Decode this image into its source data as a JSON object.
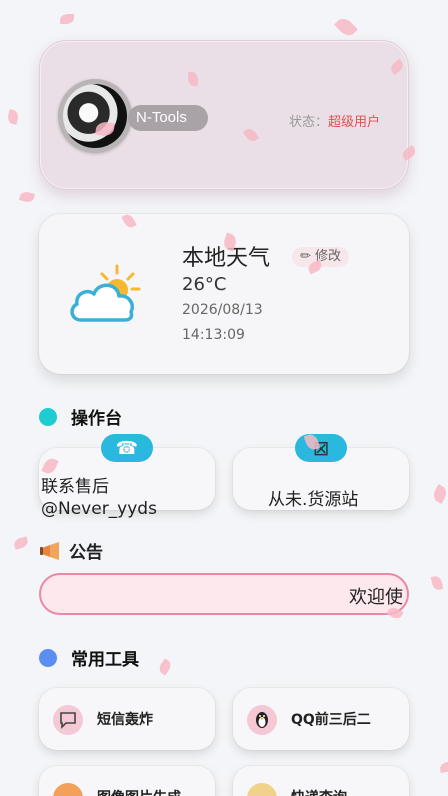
{
  "profile": {
    "app_name": "N-Tools",
    "status_label": "状态：",
    "status_value": "超级用户"
  },
  "weather": {
    "title": "本地天气",
    "edit_label": "修改",
    "temperature": "26°C",
    "date": "2026/08/13",
    "time": "14:13:09"
  },
  "console": {
    "title": "操作台",
    "tiles": [
      {
        "text": "联系售后 @Never_yyds"
      },
      {
        "text": "从未.货源站"
      }
    ]
  },
  "notice": {
    "title": "公告",
    "marquee": "欢迎使"
  },
  "tools": {
    "title": "常用工具",
    "items": [
      {
        "label": "短信轰炸"
      },
      {
        "label": "QQ前三后二"
      },
      {
        "label": "图像图片生成"
      },
      {
        "label": "快递查询"
      }
    ]
  },
  "colors": {
    "accent_teal": "#1ccdd1",
    "accent_blue": "#5b8ef1",
    "status_red": "#e0524f",
    "marquee_border": "#e98aa5"
  }
}
